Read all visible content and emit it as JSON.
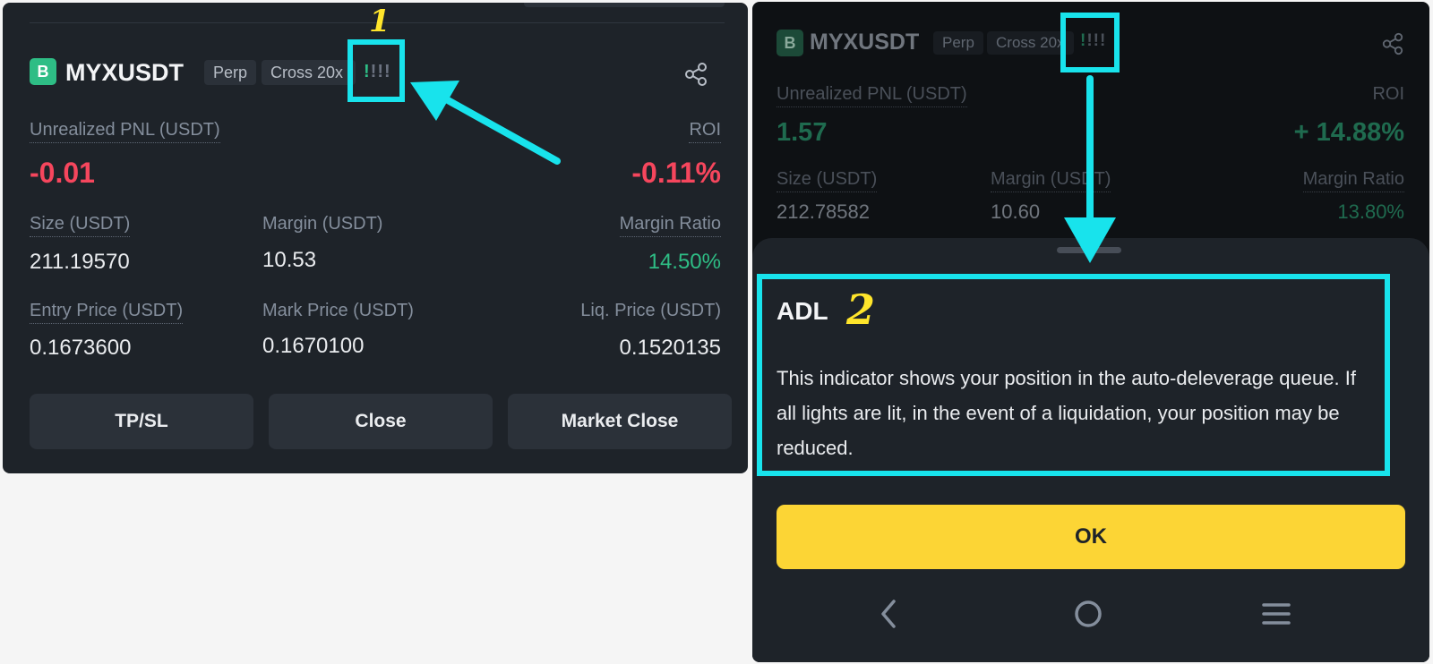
{
  "left": {
    "logo_letter": "B",
    "symbol": "MYXUSDT",
    "tag_perp": "Perp",
    "tag_cross": "Cross 20x",
    "adl": {
      "lit_text": "!",
      "off_text": "!!!",
      "lit_count": 1,
      "total": 4
    },
    "labels": {
      "unrealized_pnl": "Unrealized PNL (USDT)",
      "roi": "ROI",
      "size": "Size (USDT)",
      "margin": "Margin (USDT)",
      "margin_ratio": "Margin Ratio",
      "entry_price": "Entry Price (USDT)",
      "mark_price": "Mark Price (USDT)",
      "liq_price": "Liq. Price (USDT)"
    },
    "values": {
      "unrealized_pnl": "-0.01",
      "roi": "-0.11%",
      "size": "211.19570",
      "margin": "10.53",
      "margin_ratio": "14.50%",
      "entry_price": "0.1673600",
      "mark_price": "0.1670100",
      "liq_price": "0.1520135"
    },
    "buttons": {
      "tpsl": "TP/SL",
      "close": "Close",
      "market_close": "Market Close"
    }
  },
  "right": {
    "logo_letter": "B",
    "symbol": "MYXUSDT",
    "tag_perp": "Perp",
    "tag_cross": "Cross 20x",
    "adl": {
      "lit_text": "!",
      "off_text": "!!!"
    },
    "labels": {
      "unrealized_pnl": "Unrealized PNL (USDT)",
      "roi": "ROI",
      "size": "Size (USDT)",
      "margin": "Margin (USDT)",
      "margin_ratio": "Margin Ratio"
    },
    "values": {
      "unrealized_pnl": "1.57",
      "roi": "+ 14.88%",
      "size": "212.78582",
      "margin": "10.60",
      "margin_ratio": "13.80%"
    },
    "sheet": {
      "title": "ADL",
      "body": "This indicator shows your position in the auto-deleverage queue. If all lights are lit, in the event of a liquidation, your position may be reduced.",
      "ok_label": "OK"
    }
  },
  "annotations": {
    "marker_1": "1",
    "marker_2": "2"
  },
  "colors": {
    "accent": "#18e3ec",
    "marker": "#ffe52b",
    "negative": "#f6465d",
    "positive": "#2ebd85",
    "ok_button": "#fcd535"
  }
}
